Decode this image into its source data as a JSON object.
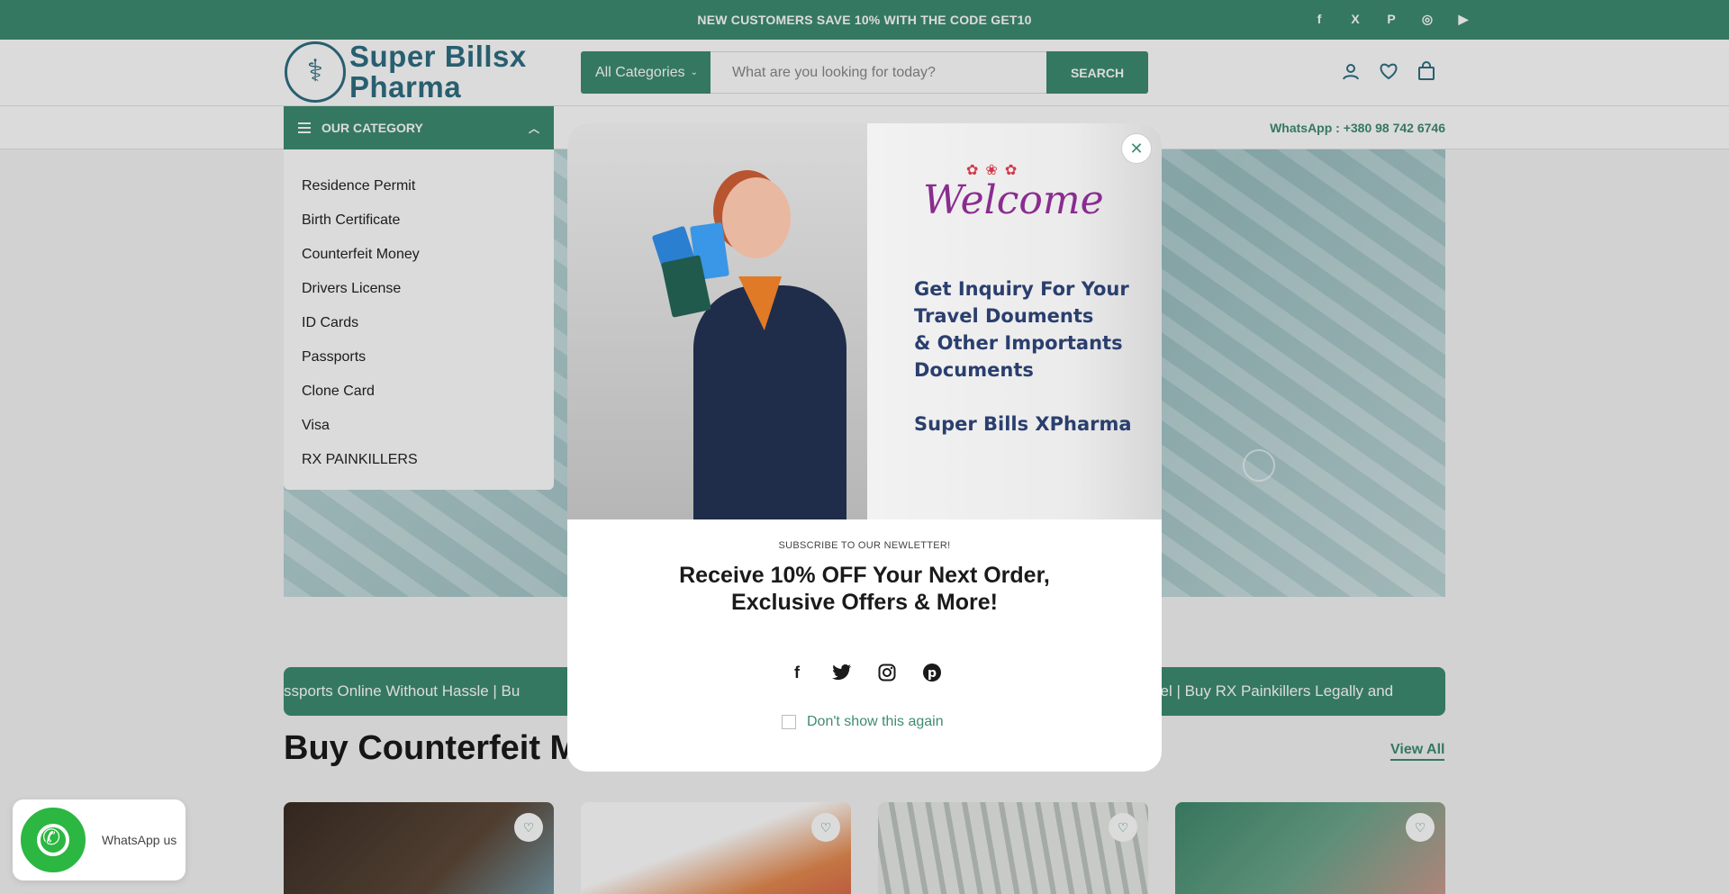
{
  "announcement": "NEW CUSTOMERS SAVE 10% WITH THE CODE GET10",
  "top_social": [
    {
      "name": "facebook-icon",
      "glyph": "f"
    },
    {
      "name": "x-icon",
      "glyph": "𝕏"
    },
    {
      "name": "pinterest-icon",
      "glyph": "P"
    },
    {
      "name": "instagram-icon",
      "glyph": "◎"
    },
    {
      "name": "youtube-icon",
      "glyph": "▶"
    }
  ],
  "logo": {
    "line1": "Super Billsx",
    "line2": "Pharma"
  },
  "search": {
    "category": "All Categories",
    "placeholder": "What are you looking for today?",
    "button": "SEARCH"
  },
  "header_icons": [
    "account-icon",
    "wishlist-icon",
    "cart-icon"
  ],
  "whatsapp_contact": "WhatsApp : +380 98 742 6746",
  "category_menu": {
    "title": "OUR CATEGORY",
    "items": [
      "Residence Permit",
      "Birth Certificate",
      "Counterfeit Money",
      "Drivers License",
      "ID Cards",
      "Passports",
      "Clone Card",
      "Visa",
      "RX PAINKILLERS"
    ]
  },
  "ticker": {
    "text": "ssports Online Without Hassle   |   Bu",
    "tail": "vel   |   Buy RX Painkillers Legally and"
  },
  "section": {
    "title": "Buy Counterfeit Mo",
    "view_all": "View All"
  },
  "popup": {
    "welcome": "Welcome",
    "promo_lines": [
      "Get Inquiry For Your",
      "Travel Douments",
      "& Other Importants",
      "Documents"
    ],
    "brand": "Super Bills XPharma",
    "subtitle": "SUBSCRIBE TO OUR NEWLETTER!",
    "headline_1": "Receive 10% OFF Your Next Order,",
    "headline_2": "Exclusive Offers & More!",
    "dont_show": "Don't show this again"
  },
  "whatsapp_widget": "WhatsApp us",
  "colors": {
    "primary": "#3e8c73",
    "logo": "#2f6f83"
  }
}
